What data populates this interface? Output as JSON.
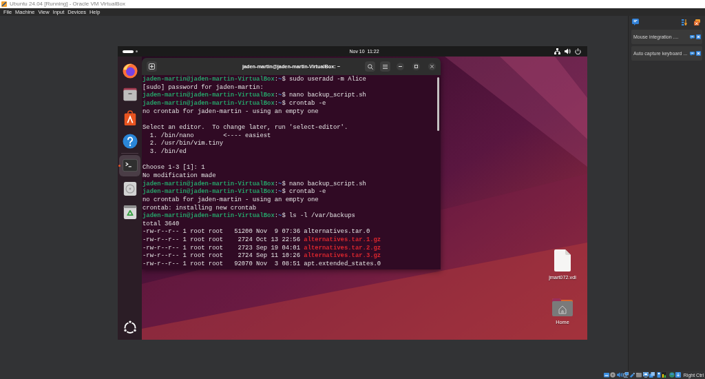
{
  "window": {
    "title": "Ubuntu 24.04 [Running] - Oracle VM VirtualBox"
  },
  "menu_bar": [
    "File",
    "Machine",
    "View",
    "Input",
    "Devices",
    "Help"
  ],
  "guest": {
    "top_bar": {
      "workspaces": [
        {
          "selected": true
        },
        {
          "selected": false
        }
      ],
      "clock": "Nov 10  11:22"
    },
    "dock": {
      "favorites": [
        {
          "kind": "browser",
          "selected": false,
          "running": false
        },
        {
          "kind": "files",
          "selected": false,
          "running": false
        },
        {
          "kind": "store",
          "selected": false,
          "running": false
        },
        {
          "kind": "help",
          "selected": false,
          "running": false
        }
      ],
      "open": [
        {
          "kind": "terminal",
          "selected": true,
          "running": true
        },
        {
          "kind": "disc",
          "selected": false,
          "running": false
        },
        {
          "kind": "trash",
          "selected": false,
          "running": false
        }
      ]
    },
    "terminal": {
      "title": "jaden-martin@jaden-martin-VirtualBox: ~",
      "lines": [
        {
          "kind": "prompt",
          "user": "jaden-martin@jaden-martin-VirtualBox",
          "sep": ":",
          "path": "~",
          "mark": "$",
          "command": "sudo useradd -m Alice"
        },
        {
          "kind": "output",
          "text": "[sudo] password for jaden-martin:"
        },
        {
          "kind": "prompt",
          "user": "jaden-martin@jaden-martin-VirtualBox",
          "sep": ":",
          "path": "~",
          "mark": "$",
          "command": "nano backup_script.sh"
        },
        {
          "kind": "prompt",
          "user": "jaden-martin@jaden-martin-VirtualBox",
          "sep": ":",
          "path": "~",
          "mark": "$",
          "command": "crontab -e"
        },
        {
          "kind": "output",
          "text": "no crontab for jaden-martin - using an empty one"
        },
        {
          "kind": "blank"
        },
        {
          "kind": "output",
          "text": "Select an editor.  To change later, run 'select-editor'."
        },
        {
          "kind": "output",
          "text": "  1. /bin/nano        <---- easiest"
        },
        {
          "kind": "output",
          "text": "  2. /usr/bin/vim.tiny"
        },
        {
          "kind": "output",
          "text": "  3. /bin/ed"
        },
        {
          "kind": "blank"
        },
        {
          "kind": "output",
          "text": "Choose 1-3 [1]: 1"
        },
        {
          "kind": "output",
          "text": "No modification made"
        },
        {
          "kind": "prompt",
          "user": "jaden-martin@jaden-martin-VirtualBox",
          "sep": ":",
          "path": "~",
          "mark": "$",
          "command": "nano backup_script.sh"
        },
        {
          "kind": "prompt",
          "user": "jaden-martin@jaden-martin-VirtualBox",
          "sep": ":",
          "path": "~",
          "mark": "$",
          "command": "crontab -e"
        },
        {
          "kind": "output",
          "text": "no crontab for jaden-martin - using an empty one"
        },
        {
          "kind": "output",
          "text": "crontab: installing new crontab"
        },
        {
          "kind": "prompt",
          "user": "jaden-martin@jaden-martin-VirtualBox",
          "sep": ":",
          "path": "~",
          "mark": "$",
          "command": "ls -l /var/backups"
        },
        {
          "kind": "output",
          "text": "total 3640"
        },
        {
          "kind": "listing",
          "text": "-rw-r--r-- 1 root root   51200 Nov  9 07:36",
          "file": "alternatives.tar.0",
          "archive": false
        },
        {
          "kind": "listing",
          "text": "-rw-r--r-- 1 root root    2724 Oct 13 22:56",
          "file": "alternatives.tar.1.gz",
          "archive": true
        },
        {
          "kind": "listing",
          "text": "-rw-r--r-- 1 root root    2723 Sep 19 04:01",
          "file": "alternatives.tar.2.gz",
          "archive": true
        },
        {
          "kind": "listing",
          "text": "-rw-r--r-- 1 root root    2724 Sep 11 10:26",
          "file": "alternatives.tar.3.gz",
          "archive": true
        },
        {
          "kind": "listing",
          "text": "-rw-r--r-- 1 root root   92070 Nov  3 08:51",
          "file": "apt.extended_states.0",
          "archive": false
        }
      ]
    },
    "desktop_icons": [
      {
        "kind": "file",
        "label": "jmart072.vdi"
      },
      {
        "kind": "home",
        "label": "Home"
      }
    ]
  },
  "notifications": [
    {
      "text": "Mouse integration ...."
    },
    {
      "text": "Auto capture keyboard ..."
    }
  ],
  "status_bar": {
    "host_key": "Right Ctrl"
  }
}
